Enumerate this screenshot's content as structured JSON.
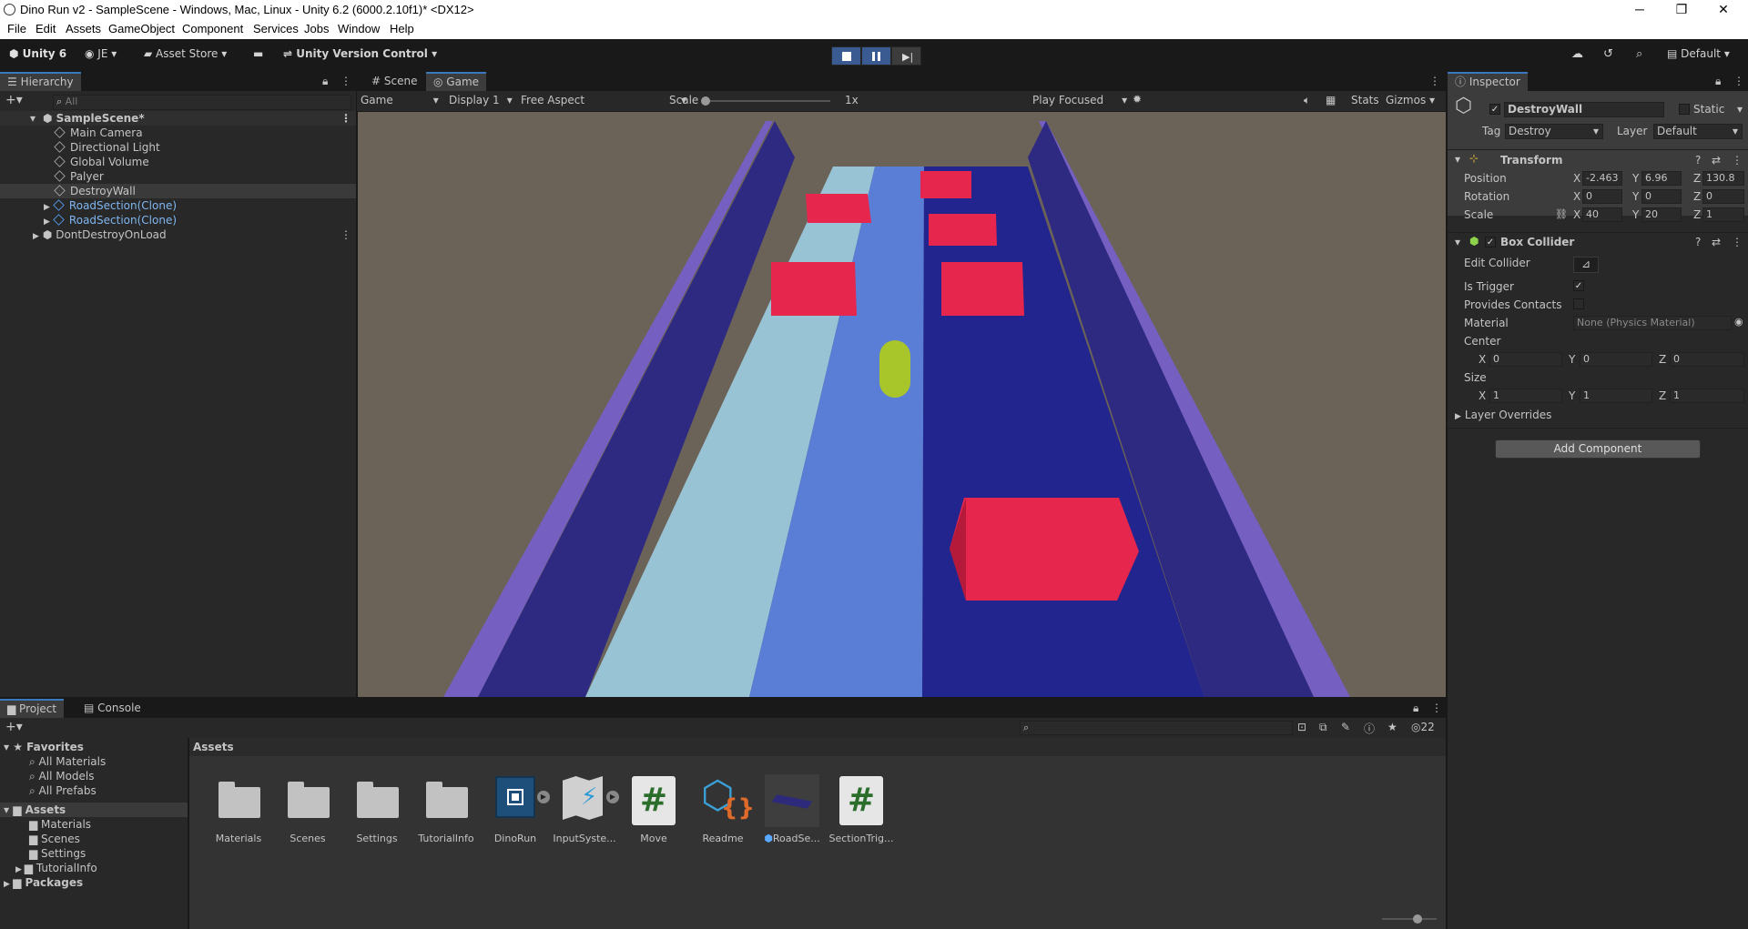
{
  "window": {
    "title": "Dino Run v2 - SampleScene - Windows, Mac, Linux - Unity 6.2 (6000.2.10f1)* <DX12>",
    "minimize": "─",
    "restore": "❐",
    "close": "✕"
  },
  "menu": [
    "File",
    "Edit",
    "Assets",
    "GameObject",
    "Component",
    "Services",
    "Jobs",
    "Window",
    "Help"
  ],
  "toolbar": {
    "unity": "Unity 6",
    "account": "JE",
    "asset_store": "Asset Store",
    "version_control": "Unity Version Control",
    "layout": "Default",
    "play_color": "#3a5b92"
  },
  "hierarchy": {
    "tab": "Hierarchy",
    "search_placeholder": "All",
    "scene": "SampleScene*",
    "items": [
      {
        "label": "Main Camera"
      },
      {
        "label": "Directional Light"
      },
      {
        "label": "Global Volume"
      },
      {
        "label": "Palyer"
      },
      {
        "label": "DestroyWall"
      },
      {
        "label": "RoadSection(Clone)"
      },
      {
        "label": "RoadSection(Clone)"
      }
    ],
    "dont_destroy": "DontDestroyOnLoad"
  },
  "game_view": {
    "tabs": [
      "Scene",
      "Game"
    ],
    "mode": "Game",
    "display": "Display 1",
    "aspect": "Free Aspect",
    "scale_label": "Scale",
    "scale_value": "1x",
    "play_focused": "Play Focused",
    "stats": "Stats",
    "gizmos": "Gizmos"
  },
  "inspector": {
    "tab": "Inspector",
    "object_name": "DestroyWall",
    "static_label": "Static",
    "tag_label": "Tag",
    "tag_value": "Destroy",
    "layer_label": "Layer",
    "layer_value": "Default",
    "transform": {
      "title": "Transform",
      "position_label": "Position",
      "rotation_label": "Rotation",
      "scale_label": "Scale",
      "position": {
        "x": "-2.463",
        "y": "6.96",
        "z": "130.8"
      },
      "rotation": {
        "x": "0",
        "y": "0",
        "z": "0"
      },
      "scale": {
        "x": "40",
        "y": "20",
        "z": "1"
      }
    },
    "box_collider": {
      "title": "Box Collider",
      "edit_collider": "Edit Collider",
      "is_trigger": "Is Trigger",
      "provides_contacts": "Provides Contacts",
      "material": "Material",
      "material_value": "None (Physics Material)",
      "center": "Center",
      "center_vals": {
        "x": "0",
        "y": "0",
        "z": "0"
      },
      "size": "Size",
      "size_vals": {
        "x": "1",
        "y": "1",
        "z": "1"
      },
      "layer_overrides": "Layer Overrides"
    },
    "add_component": "Add Component"
  },
  "project": {
    "tabs": [
      "Project",
      "Console"
    ],
    "favorites": "Favorites",
    "favorite_items": [
      "All Materials",
      "All Models",
      "All Prefabs"
    ],
    "assets_root": "Assets",
    "asset_folders": [
      "Materials",
      "Scenes",
      "Settings",
      "TutorialInfo"
    ],
    "packages": "Packages",
    "breadcrumb": "Assets",
    "count": "22",
    "assets": [
      {
        "label": "Materials",
        "icon": "folder-icon"
      },
      {
        "label": "Scenes",
        "icon": "folder-icon"
      },
      {
        "label": "Settings",
        "icon": "folder-icon"
      },
      {
        "label": "TutorialInfo",
        "icon": "folder-icon"
      },
      {
        "label": "DinoRun",
        "icon": "scene-icon"
      },
      {
        "label": "InputSyste...",
        "icon": "input-actions-icon"
      },
      {
        "label": "Move",
        "icon": "csharp-script-icon"
      },
      {
        "label": "Readme",
        "icon": "readme-icon"
      },
      {
        "label": "RoadSe...",
        "icon": "prefab-icon"
      },
      {
        "label": "SectionTrig...",
        "icon": "csharp-script-icon"
      }
    ]
  }
}
